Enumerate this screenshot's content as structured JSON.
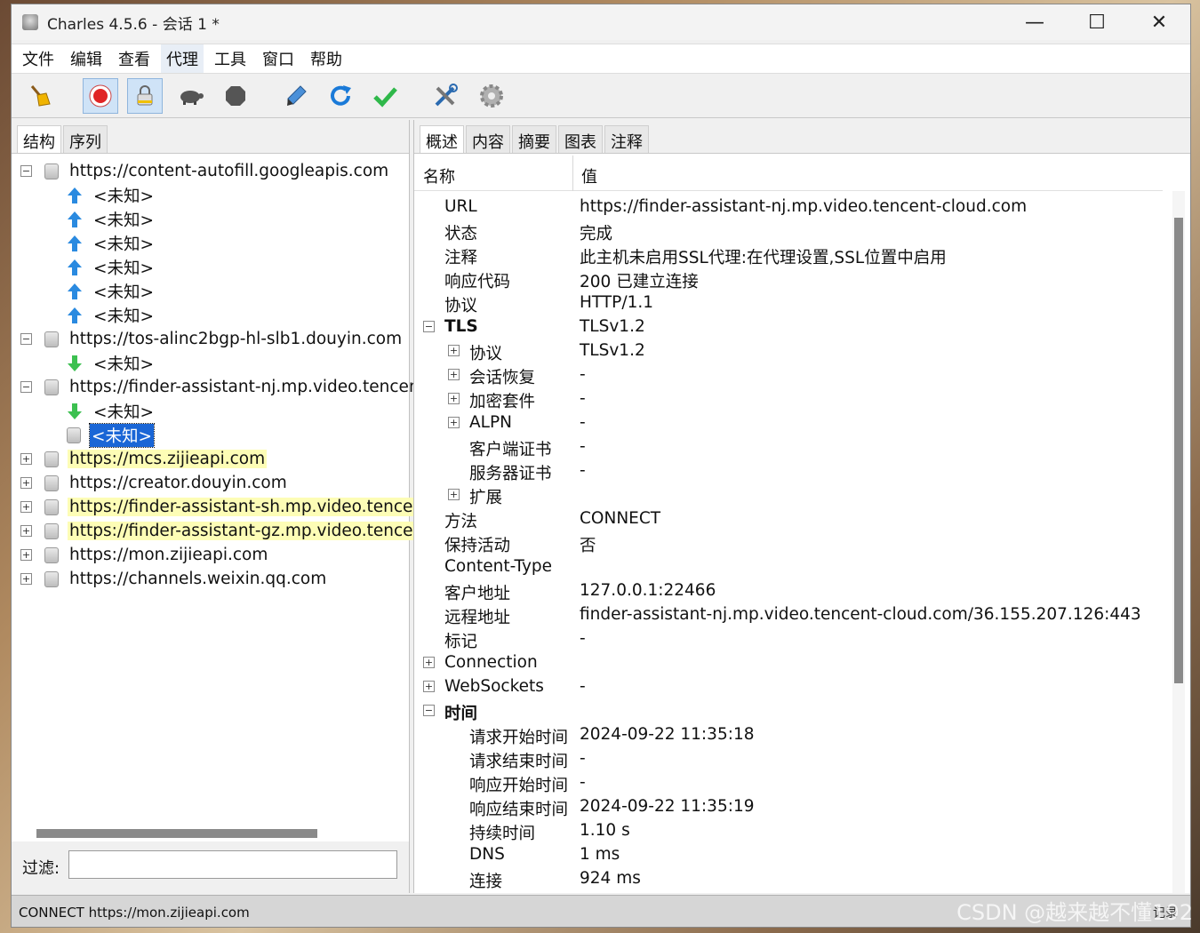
{
  "window": {
    "title": "Charles 4.5.6 - 会话 1 *"
  },
  "menu": [
    "文件",
    "编辑",
    "查看",
    "代理",
    "工具",
    "窗口",
    "帮助"
  ],
  "toolbar": [
    "broom-icon",
    "record-icon",
    "ssl-proxy-icon",
    "throttle-turtle-icon",
    "stop-hexagon-icon",
    "compose-pen-icon",
    "repeat-refresh-icon",
    "validate-check-icon",
    "tools-icon",
    "settings-gear-icon"
  ],
  "left_tabs": [
    "结构",
    "序列"
  ],
  "tree": [
    {
      "label": "https://content-autofill.googleapis.com",
      "expander": "−",
      "level": 0,
      "icon": "lock"
    },
    {
      "label": "<未知>",
      "level": 1,
      "icon": "up"
    },
    {
      "label": "<未知>",
      "level": 1,
      "icon": "up"
    },
    {
      "label": "<未知>",
      "level": 1,
      "icon": "up"
    },
    {
      "label": "<未知>",
      "level": 1,
      "icon": "up"
    },
    {
      "label": "<未知>",
      "level": 1,
      "icon": "up"
    },
    {
      "label": "<未知>",
      "level": 1,
      "icon": "up"
    },
    {
      "label": "https://tos-alinc2bgp-hl-slb1.douyin.com",
      "expander": "−",
      "level": 0,
      "icon": "lock"
    },
    {
      "label": "<未知>",
      "level": 1,
      "icon": "down"
    },
    {
      "label": "https://finder-assistant-nj.mp.video.tencent-",
      "expander": "−",
      "level": 0,
      "icon": "lock"
    },
    {
      "label": "<未知>",
      "level": 1,
      "icon": "down"
    },
    {
      "label": "<未知>",
      "level": 1,
      "icon": "lock",
      "selected": true
    },
    {
      "label": "https://mcs.zijieapi.com",
      "expander": "+",
      "level": 0,
      "icon": "lock",
      "highlight": true
    },
    {
      "label": "https://creator.douyin.com",
      "expander": "+",
      "level": 0,
      "icon": "lock"
    },
    {
      "label": "https://finder-assistant-sh.mp.video.tencent",
      "expander": "+",
      "level": 0,
      "icon": "lock",
      "highlight": true
    },
    {
      "label": "https://finder-assistant-gz.mp.video.tencent",
      "expander": "+",
      "level": 0,
      "icon": "lock",
      "highlight": true
    },
    {
      "label": "https://mon.zijieapi.com",
      "expander": "+",
      "level": 0,
      "icon": "lock"
    },
    {
      "label": "https://channels.weixin.qq.com",
      "expander": "+",
      "level": 0,
      "icon": "lock"
    }
  ],
  "filter": {
    "label": "过滤:",
    "value": ""
  },
  "right_tabs": [
    "概述",
    "内容",
    "摘要",
    "图表",
    "注释"
  ],
  "table": {
    "headers": [
      "名称",
      "值"
    ],
    "rows": [
      {
        "name": "URL",
        "value": "https://finder-assistant-nj.mp.video.tencent-cloud.com",
        "level": 0
      },
      {
        "name": "状态",
        "value": "完成",
        "level": 0
      },
      {
        "name": "注释",
        "value": "此主机未启用SSL代理:在代理设置,SSL位置中启用",
        "level": 0
      },
      {
        "name": "响应代码",
        "value": "200 已建立连接",
        "level": 0
      },
      {
        "name": "协议",
        "value": "HTTP/1.1",
        "level": 0
      },
      {
        "name": "TLS",
        "value": "TLSv1.2",
        "level": 0,
        "expander": "−",
        "bold": true
      },
      {
        "name": "协议",
        "value": "TLSv1.2",
        "level": 1,
        "expander": "+"
      },
      {
        "name": "会话恢复",
        "value": "-",
        "level": 1,
        "expander": "+"
      },
      {
        "name": "加密套件",
        "value": "-",
        "level": 1,
        "expander": "+"
      },
      {
        "name": "ALPN",
        "value": "-",
        "level": 1,
        "expander": "+"
      },
      {
        "name": "客户端证书",
        "value": "-",
        "level": 1
      },
      {
        "name": "服务器证书",
        "value": "-",
        "level": 1
      },
      {
        "name": "扩展",
        "value": "",
        "level": 1,
        "expander": "+"
      },
      {
        "name": "方法",
        "value": "CONNECT",
        "level": 0
      },
      {
        "name": "保持活动",
        "value": "否",
        "level": 0
      },
      {
        "name": "Content-Type",
        "value": "",
        "level": 0
      },
      {
        "name": "客户地址",
        "value": "127.0.0.1:22466",
        "level": 0
      },
      {
        "name": "远程地址",
        "value": "finder-assistant-nj.mp.video.tencent-cloud.com/36.155.207.126:443",
        "level": 0
      },
      {
        "name": "标记",
        "value": "-",
        "level": 0
      },
      {
        "name": "Connection",
        "value": "",
        "level": 0,
        "expander": "+"
      },
      {
        "name": "WebSockets",
        "value": "-",
        "level": 0,
        "expander": "+"
      },
      {
        "name": "时间",
        "value": "",
        "level": 0,
        "expander": "−",
        "bold": true
      },
      {
        "name": "请求开始时间",
        "value": "2024-09-22 11:35:18",
        "level": 1
      },
      {
        "name": "请求结束时间",
        "value": "-",
        "level": 1
      },
      {
        "name": "响应开始时间",
        "value": "-",
        "level": 1
      },
      {
        "name": "响应结束时间",
        "value": "2024-09-22 11:35:19",
        "level": 1
      },
      {
        "name": "持续时间",
        "value": "1.10 s",
        "level": 1
      },
      {
        "name": "DNS",
        "value": "1 ms",
        "level": 1
      },
      {
        "name": "连接",
        "value": "924 ms",
        "level": 1
      }
    ]
  },
  "status": {
    "text": "CONNECT https://mon.zijieapi.com",
    "right": "记录"
  },
  "watermark": "CSDN @越来越不懂192",
  "colors": {
    "selected": "#1a66d6",
    "highlight": "#fdfdb6"
  }
}
